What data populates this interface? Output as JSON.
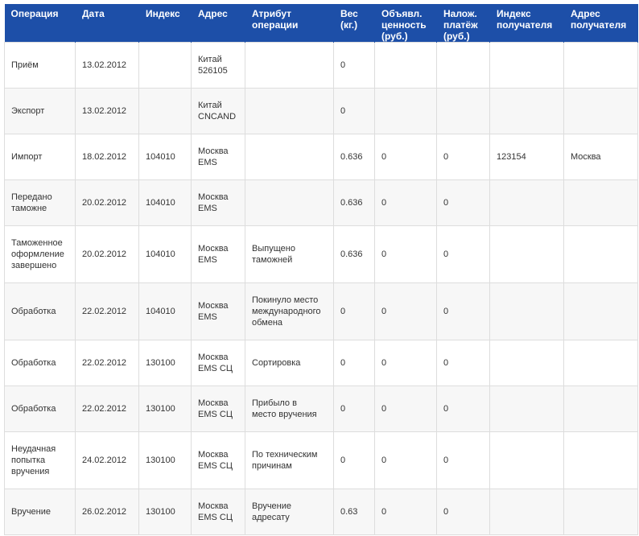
{
  "table": {
    "headers": [
      "Операция",
      "Дата",
      "Индекс",
      "Адрес",
      "Атрибут\nоперации",
      "Вес\n(кг.)",
      "Объявл.\nценность\n(руб.)",
      "Налож.\nплатёж\n(руб.)",
      "Индекс\nполучателя",
      "Адрес\nполучателя"
    ],
    "rows": [
      [
        "Приём",
        "13.02.2012",
        "",
        "Китай\n526105",
        "",
        "0",
        "",
        "",
        "",
        ""
      ],
      [
        "Экспорт",
        "13.02.2012",
        "",
        "Китай\nCNCAND",
        "",
        "0",
        "",
        "",
        "",
        ""
      ],
      [
        "Импорт",
        "18.02.2012",
        "104010",
        "Москва\nEMS",
        "",
        "0.636",
        "0",
        "0",
        "123154",
        "Москва"
      ],
      [
        "Передано\nтаможне",
        "20.02.2012",
        "104010",
        "Москва\nEMS",
        "",
        "0.636",
        "0",
        "0",
        "",
        ""
      ],
      [
        "Таможенное\nоформление\nзавершено",
        "20.02.2012",
        "104010",
        "Москва\nEMS",
        "Выпущено\nтаможней",
        "0.636",
        "0",
        "0",
        "",
        ""
      ],
      [
        "Обработка",
        "22.02.2012",
        "104010",
        "Москва\nEMS",
        "Покинуло место\nмеждународного\nобмена",
        "0",
        "0",
        "0",
        "",
        ""
      ],
      [
        "Обработка",
        "22.02.2012",
        "130100",
        "Москва\nEMS СЦ",
        "Сортировка",
        "0",
        "0",
        "0",
        "",
        ""
      ],
      [
        "Обработка",
        "22.02.2012",
        "130100",
        "Москва\nEMS СЦ",
        "Прибыло в\nместо вручения",
        "0",
        "0",
        "0",
        "",
        ""
      ],
      [
        "Неудачная\nпопытка\nвручения",
        "24.02.2012",
        "130100",
        "Москва\nEMS СЦ",
        "По техническим\nпричинам",
        "0",
        "0",
        "0",
        "",
        ""
      ],
      [
        "Вручение",
        "26.02.2012",
        "130100",
        "Москва\nEMS СЦ",
        "Вручение\nадресату",
        "0.63",
        "0",
        "0",
        "",
        ""
      ]
    ]
  },
  "colors": {
    "header_bg": "#1d4fa8",
    "header_text": "#ffffff",
    "row_alt_bg": "#f7f7f7",
    "border": "#dddddd"
  }
}
